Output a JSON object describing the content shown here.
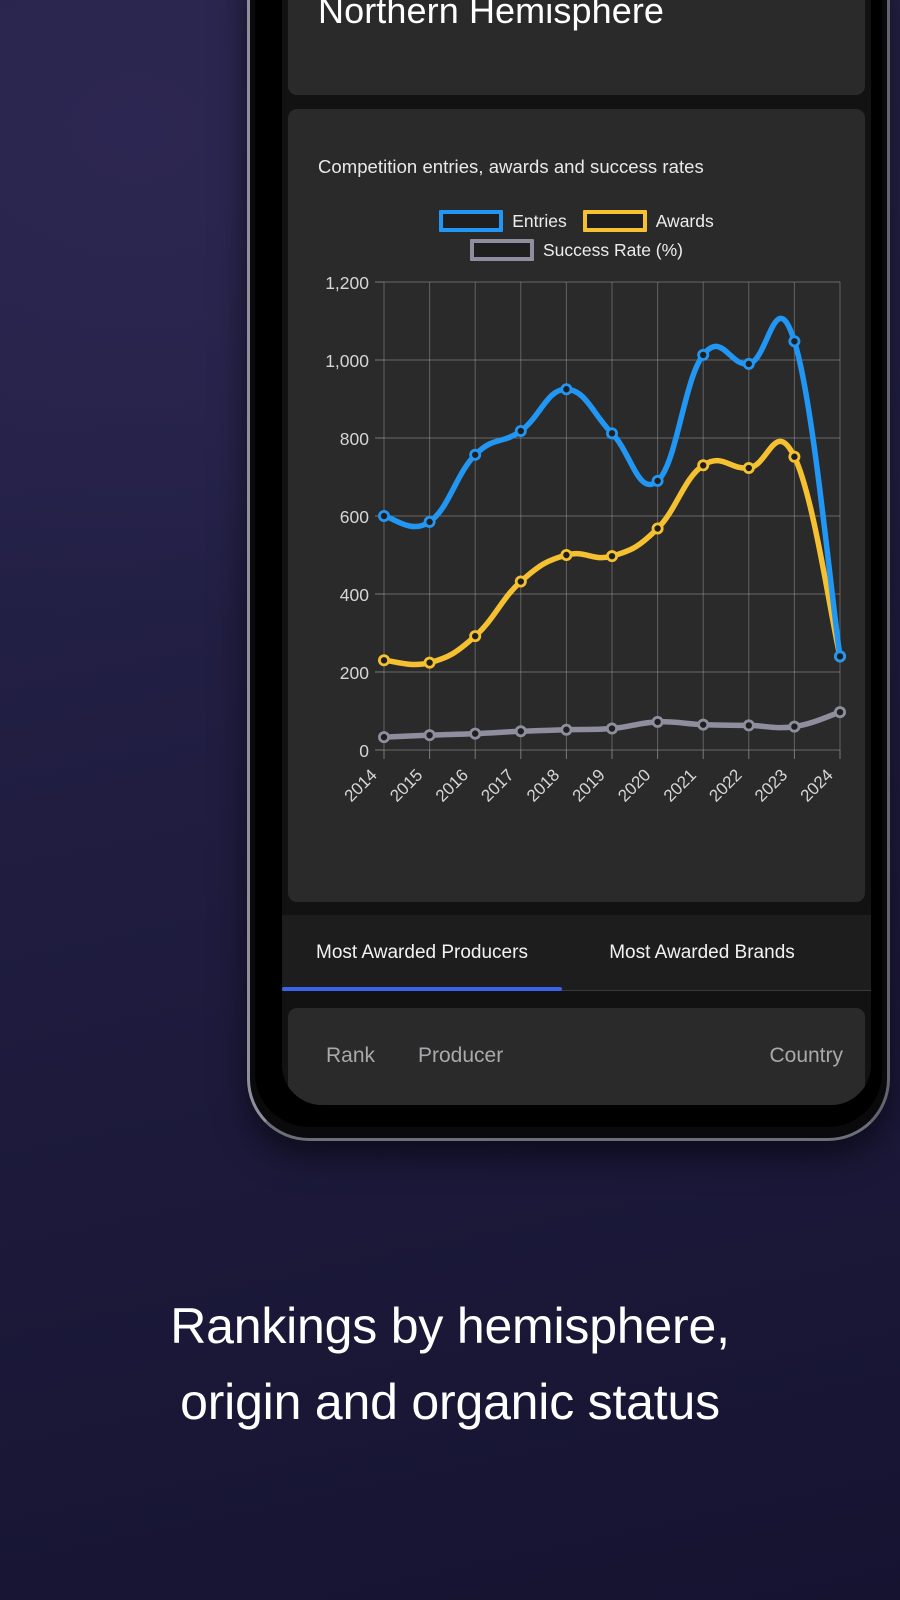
{
  "app": {
    "header_title": "Northern Hemisphere",
    "chart_subtitle": "Competition entries, awards and success rates"
  },
  "colors": {
    "entries": "#2196f3",
    "awards": "#f5c131",
    "success_rate": "#8e8e9e",
    "tab_active_underline": "#3b63ea",
    "card_background": "#2a2a2a",
    "screen_background": "#121212",
    "page_background": "#232046"
  },
  "tabs": [
    {
      "label": "Most Awarded Producers",
      "active": true
    },
    {
      "label": "Most Awarded Brands",
      "active": false
    }
  ],
  "table": {
    "headers": {
      "rank": "Rank",
      "producer": "Producer",
      "country": "Country"
    }
  },
  "caption": {
    "line1": "Rankings by hemisphere,",
    "line2": "origin and organic status"
  },
  "chart_data": {
    "type": "line",
    "title": "Competition entries, awards and success rates",
    "xlabel": "",
    "ylabel": "",
    "ylim": [
      0,
      1200
    ],
    "yticks": [
      "0",
      "200",
      "400",
      "600",
      "800",
      "1,000",
      "1,200"
    ],
    "ytick_values": [
      0,
      200,
      400,
      600,
      800,
      1000,
      1200
    ],
    "grid": true,
    "legend_position": "top",
    "x_tick_rotation": -45,
    "categories": [
      "2014",
      "2015",
      "2016",
      "2017",
      "2018",
      "2019",
      "2020",
      "2021",
      "2022",
      "2023",
      "2024"
    ],
    "series": [
      {
        "name": "Entries",
        "color": "#2196f3",
        "values": [
          600,
          585,
          757,
          818,
          925,
          812,
          690,
          1013,
          990,
          1048,
          240
        ]
      },
      {
        "name": "Awards",
        "color": "#f5c131",
        "values": [
          230,
          224,
          292,
          432,
          500,
          497,
          568,
          730,
          723,
          752,
          240
        ]
      },
      {
        "name": "Success Rate (%)",
        "color": "#8e8e9e",
        "values": [
          33,
          38,
          42,
          48,
          52,
          55,
          72,
          65,
          63,
          60,
          97
        ]
      }
    ]
  }
}
